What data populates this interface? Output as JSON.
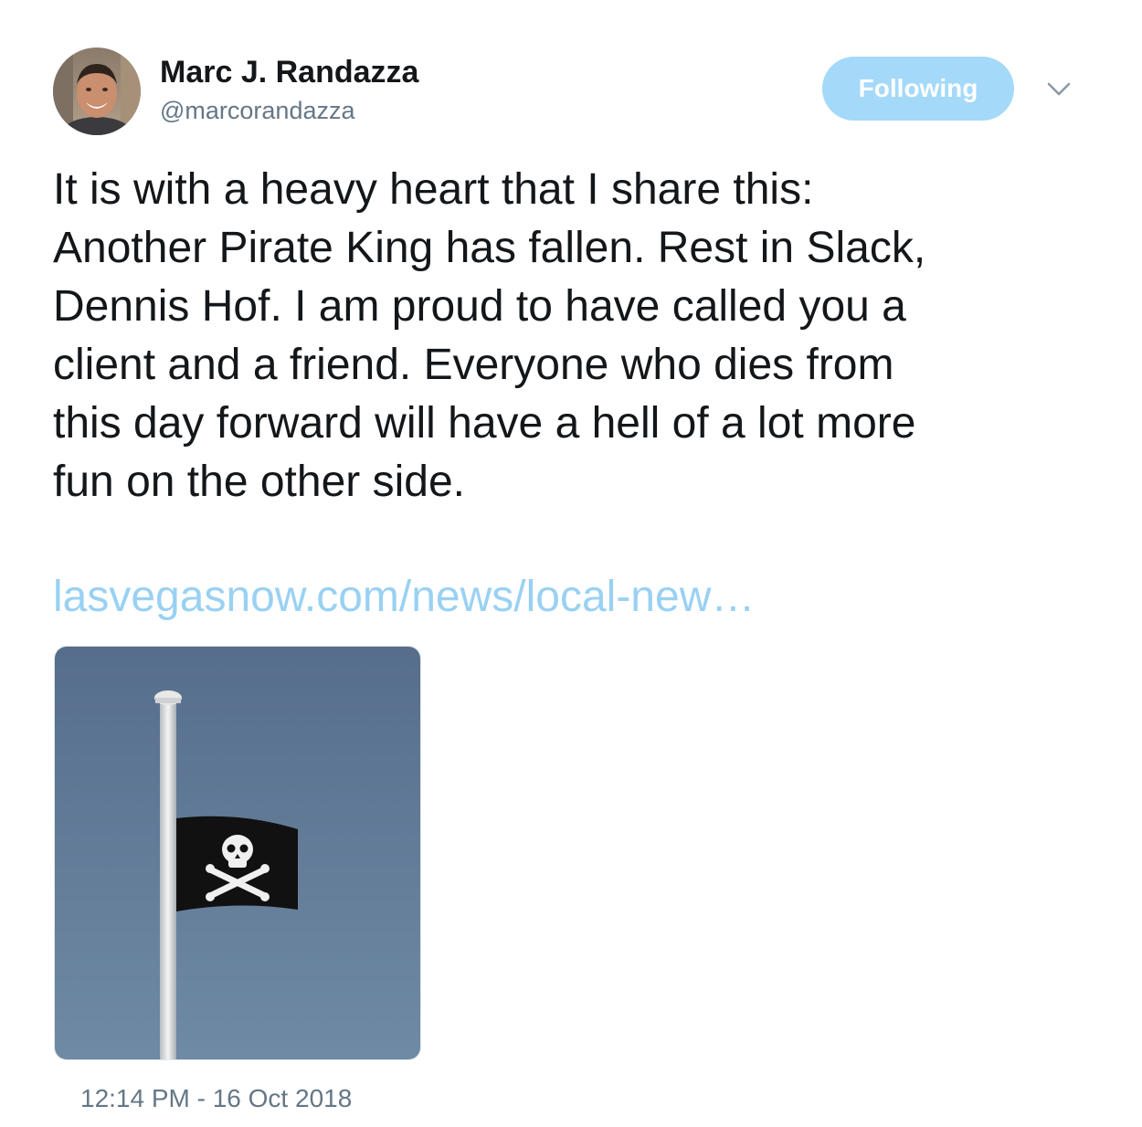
{
  "author": {
    "display_name": "Marc J. Randazza",
    "handle": "@marcorandazza",
    "avatar_icon": "profile-photo"
  },
  "follow_button": {
    "label": "Following",
    "color": "#a4d9f9"
  },
  "menu": {
    "icon": "chevron-down-icon"
  },
  "tweet": {
    "lines": [
      "It is with a heavy heart that I share this:",
      "Another Pirate King has fallen.  Rest in Slack,",
      "Dennis Hof. I am proud to have called you a",
      "client and a friend.  Everyone who dies from",
      "this day forward will have a hell of a lot more",
      "fun on the other side."
    ],
    "link_text": "lasvegasnow.com/news/local-new…",
    "link_color": "#99d1f3"
  },
  "media": {
    "description_icon": "pirate-flag-half-mast-image"
  },
  "timestamp": "12:14 PM - 16 Oct 2018"
}
